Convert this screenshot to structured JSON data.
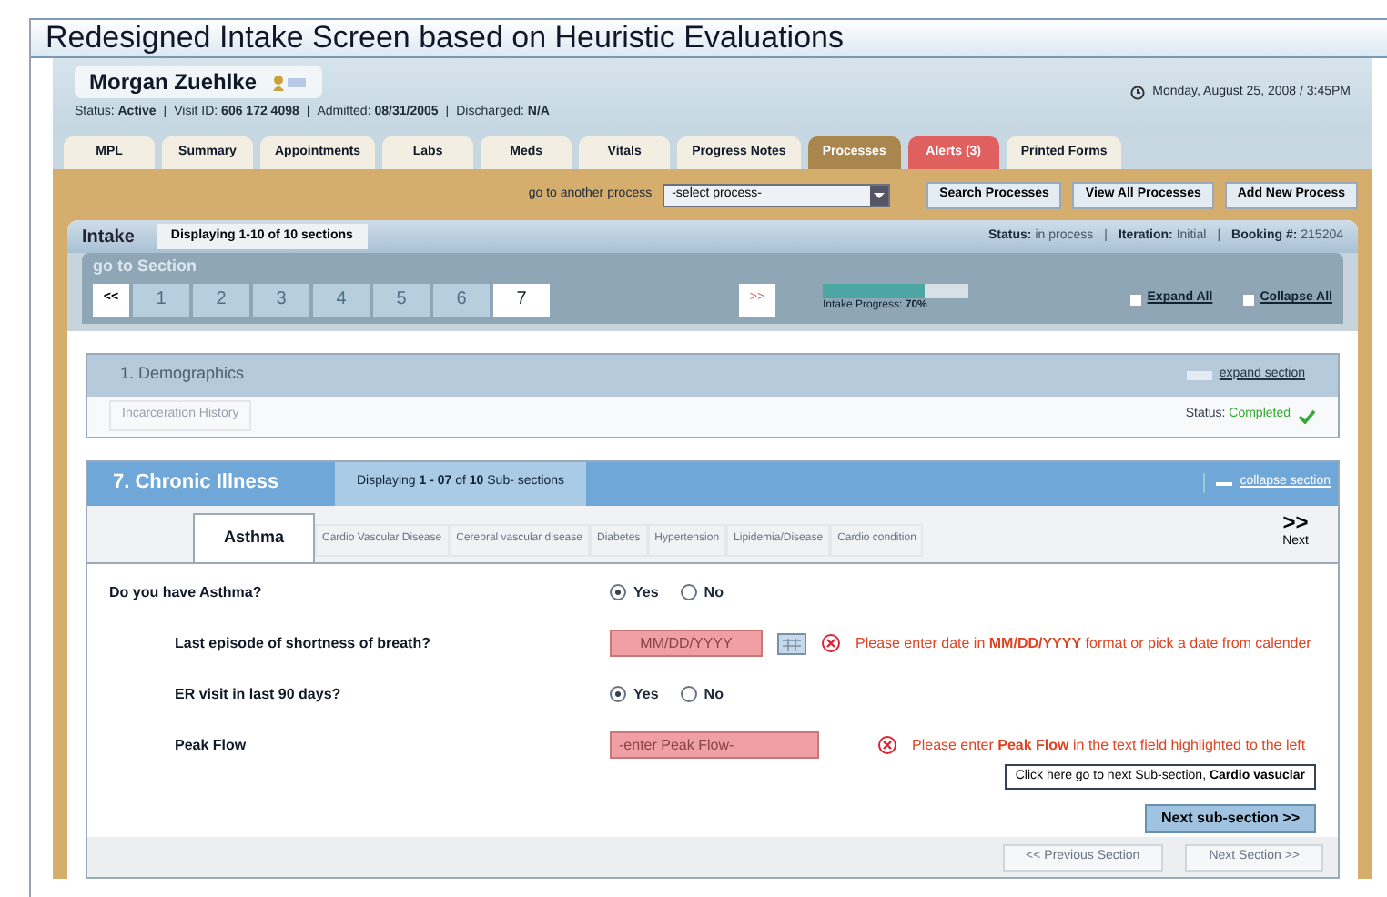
{
  "title": "Redesigned Intake Screen based on Heuristic Evaluations",
  "patient": {
    "name": "Morgan Zuehlke",
    "status_label": "Status:",
    "status": "Active",
    "visit_label": "Visit ID:",
    "visit_id": "606 172 4098",
    "admitted_label": "Admitted:",
    "admitted": "08/31/2005",
    "discharged_label": "Discharged:",
    "discharged": "N/A"
  },
  "separator": "|",
  "datetime": "Monday, August 25, 2008 / 3:45PM",
  "nav_tabs": [
    {
      "label": "MPL",
      "selected": false,
      "kind": "normal"
    },
    {
      "label": "Summary",
      "selected": false,
      "kind": "normal"
    },
    {
      "label": "Appointments",
      "selected": false,
      "kind": "normal"
    },
    {
      "label": "Labs",
      "selected": false,
      "kind": "normal"
    },
    {
      "label": "Meds",
      "selected": false,
      "kind": "normal"
    },
    {
      "label": "Vitals",
      "selected": false,
      "kind": "normal"
    },
    {
      "label": "Progress Notes",
      "selected": false,
      "kind": "normal"
    },
    {
      "label": "Processes",
      "selected": true,
      "kind": "normal"
    },
    {
      "label": "Alerts (3)",
      "selected": false,
      "kind": "alert"
    },
    {
      "label": "Printed Forms",
      "selected": false,
      "kind": "normal"
    }
  ],
  "process_bar": {
    "label": "go to another process",
    "select": "-select process-",
    "buttons": [
      "Search Processes",
      "View All Processes",
      "Add New Process"
    ]
  },
  "intake": {
    "title": "Intake",
    "displaying": "Displaying 1-10 of 10 sections",
    "status_label": "Status:",
    "status": "in process",
    "iteration_label": "Iteration:",
    "iteration": "Initial",
    "booking_label": "Booking #:",
    "booking": "215204"
  },
  "goto": {
    "title": "go to Section",
    "first": "<<",
    "last": ">>",
    "pages": [
      {
        "label": "1",
        "selected": false
      },
      {
        "label": "2",
        "selected": false
      },
      {
        "label": "3",
        "selected": false
      },
      {
        "label": "4",
        "selected": false
      },
      {
        "label": "5",
        "selected": false
      },
      {
        "label": "6",
        "selected": false
      },
      {
        "label": "7",
        "selected": true
      }
    ],
    "progress": {
      "level": 0.7,
      "label": "Intake Progress:",
      "value": "70%"
    },
    "expand_all": {
      "label": "Expand All",
      "checked": false
    },
    "collapse_all": {
      "label": "Collapse All",
      "checked": false
    }
  },
  "demographics": {
    "title": "1. Demographics",
    "action": "expand section",
    "items": [
      "Incarceration History"
    ],
    "status_label": "Status:",
    "status": "Completed"
  },
  "chronic": {
    "title": "7. Chronic Illness",
    "displaying": "Displaying **1 - 07** of **10** Sub- sections",
    "action": "collapse section",
    "subtabs": [
      {
        "label": "Asthma",
        "selected": true
      },
      {
        "label": "Cardio Vascular Disease",
        "selected": false
      },
      {
        "label": "Cerebral vascular disease",
        "selected": false
      },
      {
        "label": "Diabetes",
        "selected": false
      },
      {
        "label": "Hypertension",
        "selected": false
      },
      {
        "label": "Lipidemia/Disease",
        "selected": false
      },
      {
        "label": "Cardio condition",
        "selected": false
      }
    ],
    "next": {
      "symbol": ">>",
      "label": "Next"
    },
    "questions": [
      {
        "kind": "radio",
        "label": "Do you have Asthma?",
        "options": [
          {
            "label": "Yes",
            "selected": true
          },
          {
            "label": "No",
            "selected": false
          }
        ],
        "children": [
          {
            "kind": "date",
            "label": "Last episode of shortness of breath?",
            "placeholder": "MM/DD/YYYY",
            "error": "Please enter date in **MM/DD/YYYY** format or pick a date from calender"
          },
          {
            "kind": "radio",
            "label": "ER visit in last 90 days?",
            "options": [
              {
                "label": "Yes",
                "selected": true
              },
              {
                "label": "No",
                "selected": false
              }
            ]
          },
          {
            "kind": "text",
            "label": "Peak Flow",
            "placeholder": "-enter Peak Flow-",
            "error": "Please enter **Peak Flow** in the text field highlighted to the left"
          }
        ]
      }
    ],
    "tooltip": "Click here go to next Sub-section, **Cardio vasuclar**",
    "next_sub": "Next sub-section >>",
    "bottom_buttons": [
      {
        "label": "<< Previous Section",
        "disabled": true
      },
      {
        "label": "Next Section >>",
        "disabled": true
      }
    ]
  }
}
